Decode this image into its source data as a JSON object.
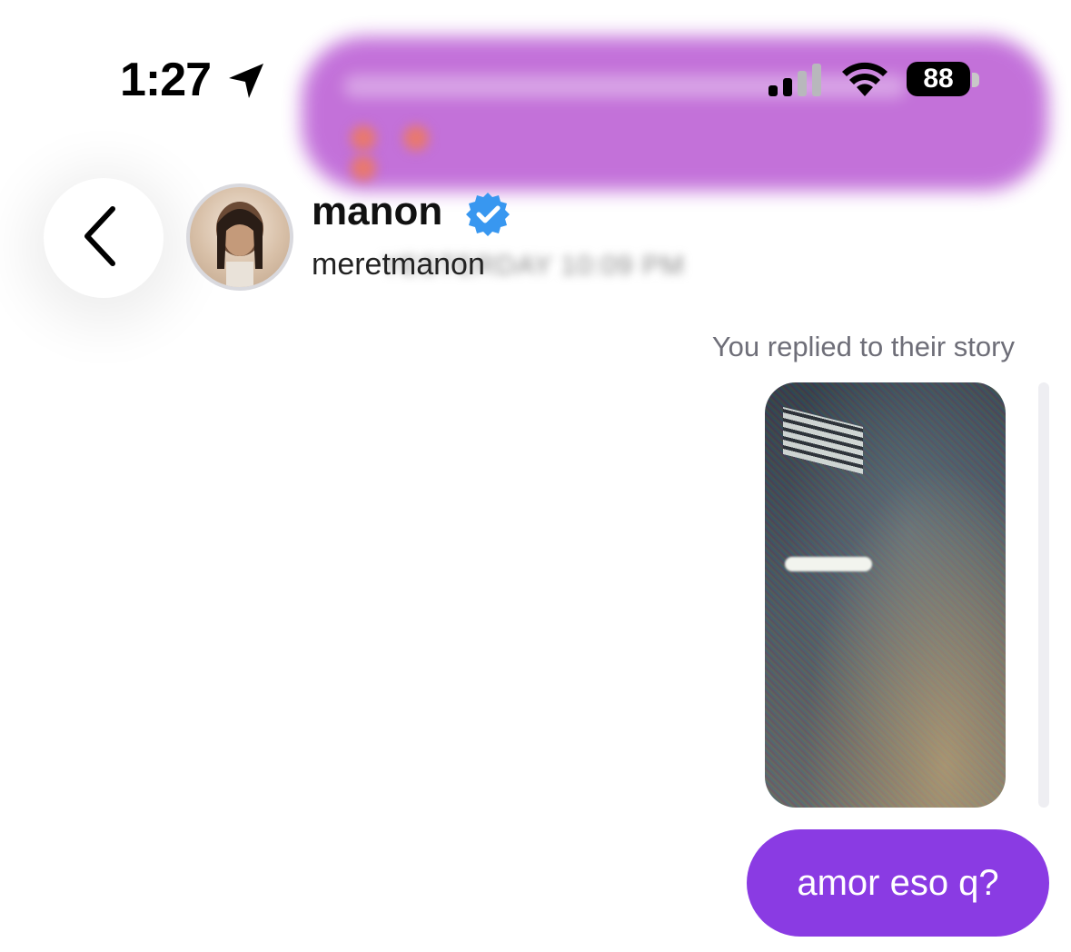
{
  "status_bar": {
    "time": "1:27",
    "battery": "88",
    "location_icon": "location-arrow-icon",
    "signal_icon": "cellular-signal-icon",
    "wifi_icon": "wifi-icon"
  },
  "header": {
    "back_icon": "chevron-left-icon",
    "display_name": "manon",
    "verified_icon": "verified-badge-icon",
    "username": "meretmanon",
    "timestamp": "YESTERDAY 10:09 PM"
  },
  "conversation": {
    "story_caption": "You replied to their story",
    "message": "amor eso q?"
  },
  "colors": {
    "message_bubble": "#8a3be3",
    "verified_badge": "#3897f0",
    "notification_banner": "#c06ad8"
  }
}
